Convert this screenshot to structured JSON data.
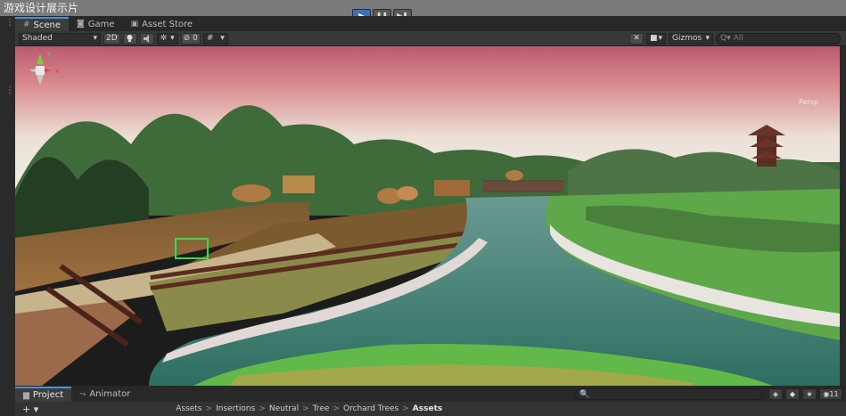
{
  "window": {
    "title": "游戏设计展示片"
  },
  "play_controls": [
    {
      "name": "play-button",
      "glyph": "▶",
      "active": true
    },
    {
      "name": "pause-button",
      "glyph": "❚❚",
      "active": false
    },
    {
      "name": "step-button",
      "glyph": "▶❚",
      "active": false
    }
  ],
  "tabs": [
    {
      "label": "Scene",
      "icon": "hash-icon",
      "glyph": "#",
      "active": true
    },
    {
      "label": "Game",
      "icon": "gamepad-icon",
      "glyph": "◙",
      "active": false
    },
    {
      "label": "Asset Store",
      "icon": "store-bag-icon",
      "glyph": "▣",
      "active": false
    }
  ],
  "scene_toolbar": {
    "draw_mode": "Shaded",
    "mode_2d": "2D",
    "light_icon": "lightbulb-icon",
    "audio_icon": "speaker-icon",
    "effects_icon": "effects-icon",
    "hidden_count": "0",
    "grid_icon": "grid-icon",
    "tools_icon": "tools-icon",
    "camera_icon": "camera-icon",
    "gizmos_label": "Gizmos",
    "search_placeholder": "All",
    "search_value": "",
    "search_prefix": "Q▾"
  },
  "gizmo": {
    "label": "Persp"
  },
  "bottom_tabs": [
    {
      "label": "Project",
      "icon": "folder-icon",
      "glyph": "▆",
      "active": true
    },
    {
      "label": "Animator",
      "icon": "animator-icon",
      "glyph": "⤳",
      "active": false
    }
  ],
  "bottom_toolbar": {
    "search_prefix": "🔍",
    "layers_count": "11",
    "lock_icon": "lock-icon",
    "menu_icon": "menu-icon"
  },
  "breadcrumb": {
    "add_label": "+ ▾",
    "items": [
      "Assets",
      "Insertions",
      "Neutral",
      "Tree",
      "Orchard Trees",
      "Assets"
    ]
  },
  "colors": {
    "accent": "#3a72b8",
    "sky_top": "#c8667a",
    "sky_bottom": "#e9ddd4",
    "water": "#3f7f74",
    "grass": "#5fb54a"
  }
}
